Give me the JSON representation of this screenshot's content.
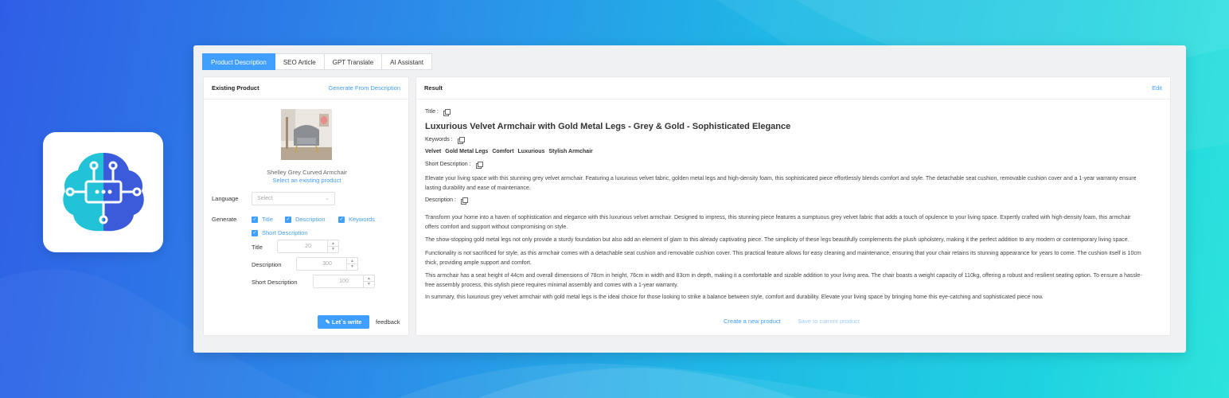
{
  "colors": {
    "accent": "#409eff",
    "logo_teal": "#22c3d6",
    "logo_blue": "#3b5bdb"
  },
  "logo": {
    "icon": "ai-brain-icon"
  },
  "tabs": [
    {
      "label": "Product Description",
      "active": true
    },
    {
      "label": "SEO Article",
      "active": false
    },
    {
      "label": "GPT Translate",
      "active": false
    },
    {
      "label": "AI Assistant",
      "active": false
    }
  ],
  "left_panel": {
    "title": "Existing Product",
    "generate_link": "Generate From Description",
    "product_name": "Shelley Grey Curved Armchair",
    "select_existing": "Select an existing product",
    "language_label": "Language",
    "language_placeholder": "Select",
    "generate_label": "Generate",
    "checks": {
      "title": "Title",
      "description": "Description",
      "keywords": "Keywords",
      "short_description": "Short Description"
    },
    "lengths": {
      "title_label": "Title",
      "title_value": "20",
      "description_label": "Description",
      "description_value": "300",
      "short_label": "Short Description",
      "short_value": "100"
    },
    "write_button": "Let`s write",
    "feedback": "feedback"
  },
  "result": {
    "header": "Result",
    "edit": "Edit",
    "title_label": "Title :",
    "title": "Luxurious Velvet Armchair with Gold Metal Legs - Grey & Gold - Sophisticated Elegance",
    "keywords_label": "Keywords :",
    "keywords": [
      "Velvet",
      "Gold Metal Legs",
      "Comfort",
      "Luxurious",
      "Stylish Armchair"
    ],
    "short_label": "Short Description :",
    "short_description": "Elevate your living space with this stunning grey velvet armchair. Featuring a luxurious velvet fabric, golden metal legs and high-density foam, this sophisticated piece effortlessly blends comfort and style. The detachable seat cushion, removable cushion cover and a 1-year warranty ensure lasting durability and ease of maintenance.",
    "description_label": "Description :",
    "paragraphs": [
      "Transform your home into a haven of sophistication and elegance with this luxurious velvet armchair. Designed to impress, this stunning piece features a sumptuous grey velvet fabric that adds a touch of opulence to your living space. Expertly crafted with high-density foam, this armchair offers comfort and support without compromising on style.",
      "The show-stopping gold metal legs not only provide a sturdy foundation but also add an element of glam to this already captivating piece. The simplicity of these legs beautifully complements the plush upholstery, making it the perfect addition to any modern or contemporary living space.",
      "Functionality is not sacrificed for style, as this armchair comes with a detachable seat cushion and removable cushion cover. This practical feature allows for easy cleaning and maintenance, ensuring that your chair retains its stunning appearance for years to come. The cushion itself is 10cm thick, providing ample support and comfort.",
      "This armchair has a seat height of 44cm and overall dimensions of 78cm in height, 76cm in width and 83cm in depth, making it a comfortable and sizable addition to your living area. The chair boasts a weight capacity of 110kg, offering a robust and resilient seating option. To ensure a hassle-free assembly process, this stylish piece requires minimal assembly and comes with a 1-year warranty.",
      "In summary, this luxurious grey velvet armchair with gold metal legs is the ideal choice for those looking to strike a balance between style, comfort and durability. Elevate your living space by bringing home this eye-catching and sophisticated piece now."
    ],
    "create_new": "Create a new product",
    "save_current": "Save to current product"
  }
}
